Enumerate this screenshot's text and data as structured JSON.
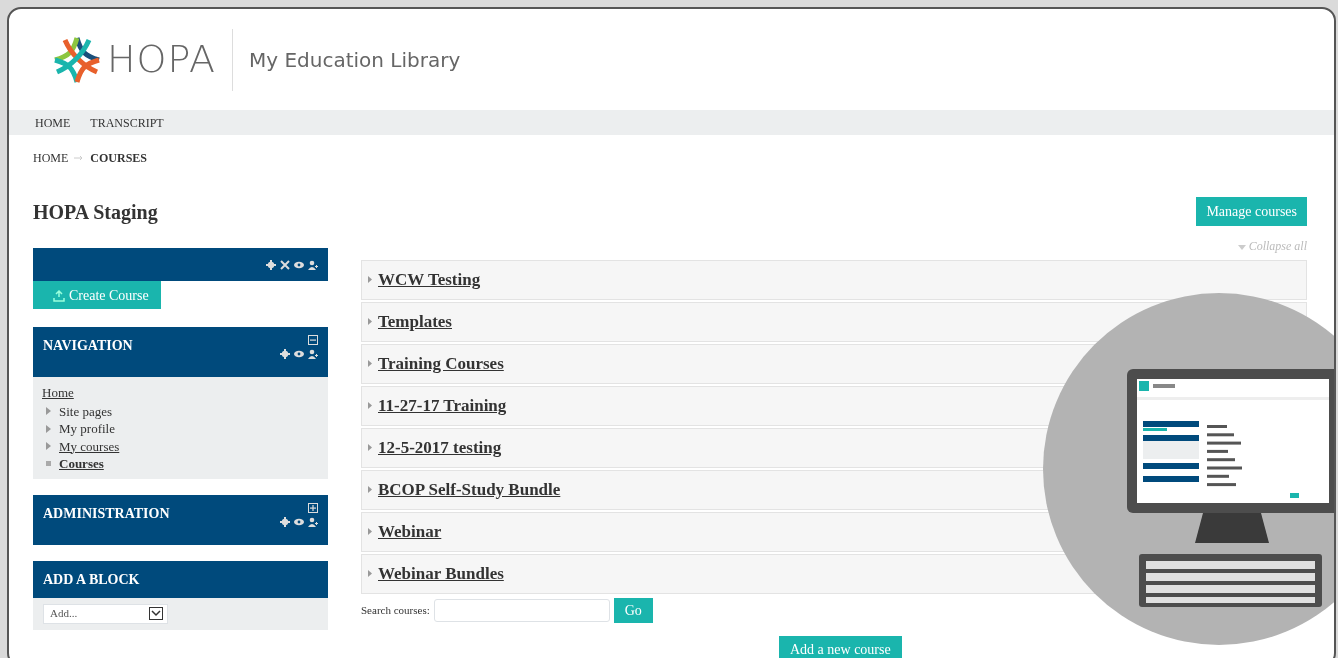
{
  "header": {
    "logo_text": "HOPA",
    "site_title": "My Education Library"
  },
  "menu": [
    {
      "label": "HOME"
    },
    {
      "label": "TRANSCRIPT"
    }
  ],
  "breadcrumb": [
    {
      "label": "HOME",
      "current": false
    },
    {
      "label": "COURSES",
      "current": true
    }
  ],
  "page_title": "HOPA Staging",
  "manage_button": "Manage courses",
  "blocks": [
    {
      "kind": "actions",
      "button": "Create Course"
    },
    {
      "kind": "tree",
      "title": "NAVIGATION",
      "expanded": true,
      "tree": [
        {
          "label": "Home",
          "linked": true,
          "selected": false,
          "children": [
            {
              "label": "Site pages",
              "linked": false,
              "expandable": true,
              "selected": false
            },
            {
              "label": "My profile",
              "linked": false,
              "expandable": true,
              "selected": false
            },
            {
              "label": "My courses",
              "linked": true,
              "expandable": true,
              "selected": false
            },
            {
              "label": "Courses",
              "linked": true,
              "expandable": false,
              "selected": true
            }
          ]
        }
      ]
    },
    {
      "kind": "empty",
      "title": "ADMINISTRATION",
      "expanded": false
    },
    {
      "kind": "select",
      "title": "ADD A BLOCK",
      "select_value": "Add..."
    }
  ],
  "collapse_all": "Collapse all",
  "categories": [
    {
      "label": "WCW Testing"
    },
    {
      "label": "Templates"
    },
    {
      "label": "Training Courses"
    },
    {
      "label": "11-27-17 Training"
    },
    {
      "label": "12-5-2017 testing"
    },
    {
      "label": "BCOP Self-Study Bundle"
    },
    {
      "label": "Webinar"
    },
    {
      "label": "Webinar Bundles"
    }
  ],
  "search": {
    "label": "Search courses:",
    "button": "Go"
  },
  "add_button": "Add a new course"
}
